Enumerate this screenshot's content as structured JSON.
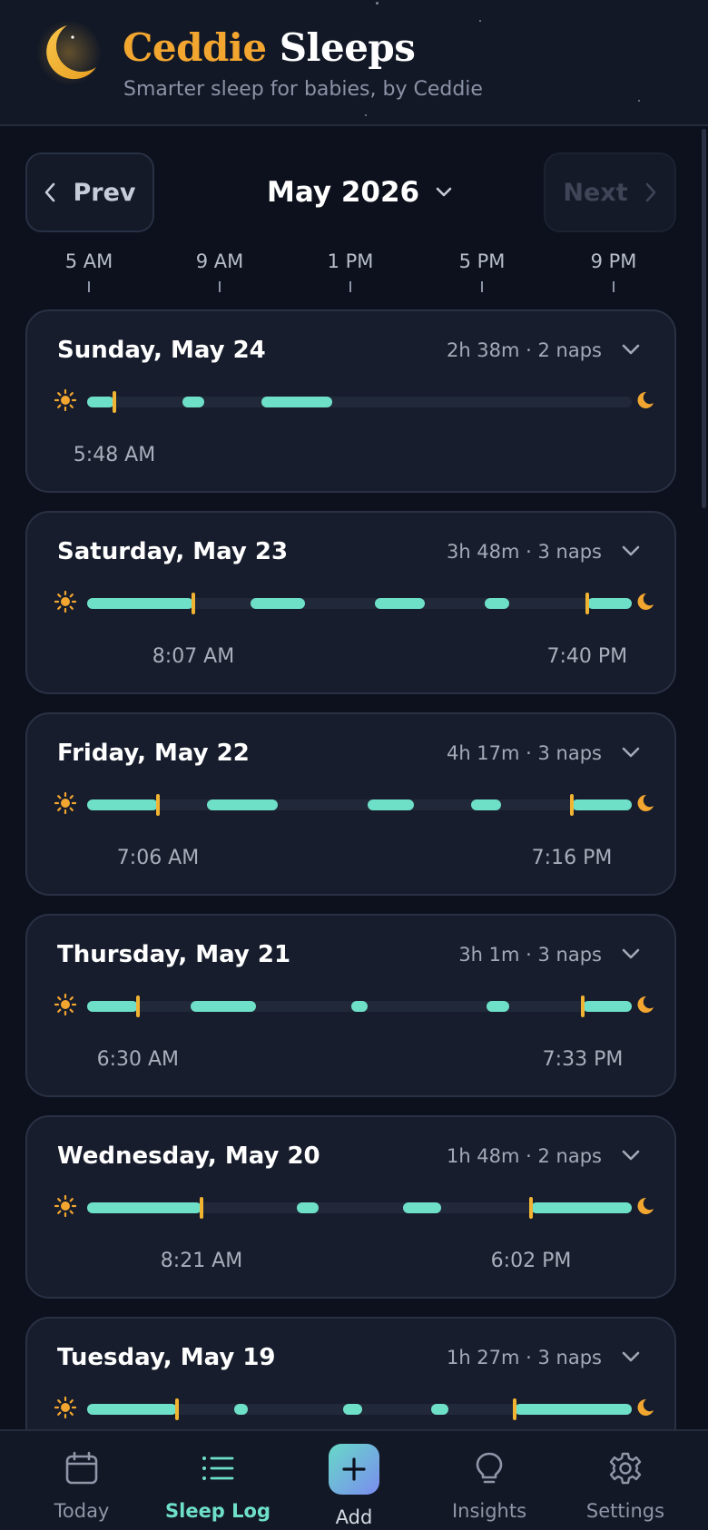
{
  "header": {
    "title_part1": "Ceddie",
    "title_part2": "Sleeps",
    "subtitle": "Smarter sleep for babies, by Ceddie"
  },
  "month_nav": {
    "prev_label": "Prev",
    "next_label": "Next",
    "month": "May 2026",
    "next_disabled": true
  },
  "time_axis": [
    "5 AM",
    "9 AM",
    "1 PM",
    "5 PM",
    "9 PM"
  ],
  "days": [
    {
      "date": "Sunday, May 24",
      "summary": "2h 38m · 2 naps",
      "wake_time": "5:48 AM",
      "bed_time": "",
      "wake_fraction": 0.05,
      "bed_fraction": null,
      "naps": [
        [
          0.0,
          0.05
        ],
        [
          0.175,
          0.215
        ],
        [
          0.32,
          0.45
        ]
      ]
    },
    {
      "date": "Saturday, May 23",
      "summary": "3h 48m · 3 naps",
      "wake_time": "8:07 AM",
      "bed_time": "7:40 PM",
      "wake_fraction": 0.195,
      "bed_fraction": 0.918,
      "naps": [
        [
          0.0,
          0.195
        ],
        [
          0.3,
          0.4
        ],
        [
          0.528,
          0.62
        ],
        [
          0.73,
          0.775
        ],
        [
          0.918,
          1.0
        ]
      ]
    },
    {
      "date": "Friday, May 22",
      "summary": "4h 17m · 3 naps",
      "wake_time": "7:06 AM",
      "bed_time": "7:16 PM",
      "wake_fraction": 0.13,
      "bed_fraction": 0.89,
      "naps": [
        [
          0.0,
          0.13
        ],
        [
          0.22,
          0.35
        ],
        [
          0.515,
          0.6
        ],
        [
          0.705,
          0.76
        ],
        [
          0.89,
          1.0
        ]
      ]
    },
    {
      "date": "Thursday, May 21",
      "summary": "3h 1m · 3 naps",
      "wake_time": "6:30 AM",
      "bed_time": "7:33 PM",
      "wake_fraction": 0.093,
      "bed_fraction": 0.91,
      "naps": [
        [
          0.0,
          0.093
        ],
        [
          0.19,
          0.31
        ],
        [
          0.485,
          0.515
        ],
        [
          0.733,
          0.775
        ],
        [
          0.91,
          1.0
        ]
      ]
    },
    {
      "date": "Wednesday, May 20",
      "summary": "1h 48m · 2 naps",
      "wake_time": "8:21 AM",
      "bed_time": "6:02 PM",
      "wake_fraction": 0.21,
      "bed_fraction": 0.815,
      "naps": [
        [
          0.0,
          0.21
        ],
        [
          0.385,
          0.425
        ],
        [
          0.58,
          0.65
        ],
        [
          0.815,
          1.0
        ]
      ]
    },
    {
      "date": "Tuesday, May 19",
      "summary": "1h 27m · 3 naps",
      "wake_time": "",
      "bed_time": "",
      "wake_fraction": 0.165,
      "bed_fraction": 0.785,
      "naps": [
        [
          0.0,
          0.165
        ],
        [
          0.27,
          0.295
        ],
        [
          0.47,
          0.505
        ],
        [
          0.632,
          0.663
        ],
        [
          0.785,
          1.0
        ]
      ]
    }
  ],
  "bottom_nav": {
    "today": "Today",
    "sleep_log": "Sleep Log",
    "add": "Add",
    "insights": "Insights",
    "settings": "Settings",
    "active": "sleep_log"
  },
  "colors": {
    "background": "#0c111d",
    "card": "#171d2c",
    "accent_teal": "#6fe0c8",
    "accent_orange": "#f2a630",
    "marker": "#f0b332"
  }
}
